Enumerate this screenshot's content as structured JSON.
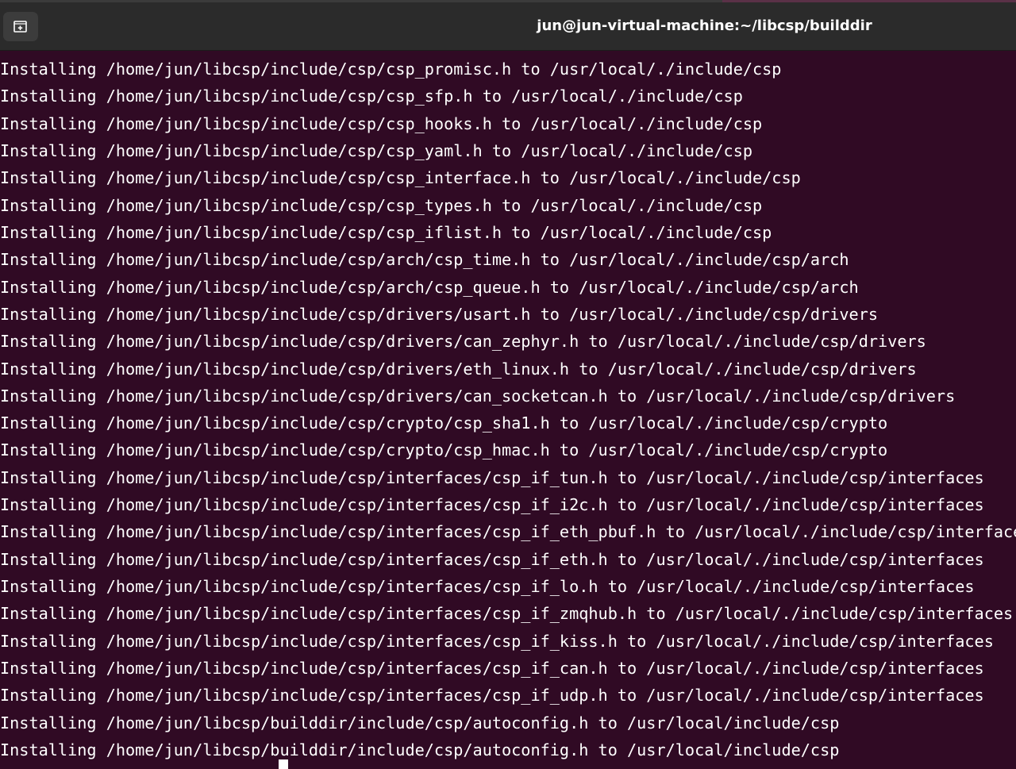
{
  "window": {
    "title": "jun@jun-virtual-machine:~/libcsp/builddir"
  },
  "toolbar": {
    "new_tab_icon": "new-tab-icon"
  },
  "terminal": {
    "lines": [
      "Installing /home/jun/libcsp/include/csp/csp_promisc.h to /usr/local/./include/csp",
      "Installing /home/jun/libcsp/include/csp/csp_sfp.h to /usr/local/./include/csp",
      "Installing /home/jun/libcsp/include/csp/csp_hooks.h to /usr/local/./include/csp",
      "Installing /home/jun/libcsp/include/csp/csp_yaml.h to /usr/local/./include/csp",
      "Installing /home/jun/libcsp/include/csp/csp_interface.h to /usr/local/./include/csp",
      "Installing /home/jun/libcsp/include/csp/csp_types.h to /usr/local/./include/csp",
      "Installing /home/jun/libcsp/include/csp/csp_iflist.h to /usr/local/./include/csp",
      "Installing /home/jun/libcsp/include/csp/arch/csp_time.h to /usr/local/./include/csp/arch",
      "Installing /home/jun/libcsp/include/csp/arch/csp_queue.h to /usr/local/./include/csp/arch",
      "Installing /home/jun/libcsp/include/csp/drivers/usart.h to /usr/local/./include/csp/drivers",
      "Installing /home/jun/libcsp/include/csp/drivers/can_zephyr.h to /usr/local/./include/csp/drivers",
      "Installing /home/jun/libcsp/include/csp/drivers/eth_linux.h to /usr/local/./include/csp/drivers",
      "Installing /home/jun/libcsp/include/csp/drivers/can_socketcan.h to /usr/local/./include/csp/drivers",
      "Installing /home/jun/libcsp/include/csp/crypto/csp_sha1.h to /usr/local/./include/csp/crypto",
      "Installing /home/jun/libcsp/include/csp/crypto/csp_hmac.h to /usr/local/./include/csp/crypto",
      "Installing /home/jun/libcsp/include/csp/interfaces/csp_if_tun.h to /usr/local/./include/csp/interfaces",
      "Installing /home/jun/libcsp/include/csp/interfaces/csp_if_i2c.h to /usr/local/./include/csp/interfaces",
      "Installing /home/jun/libcsp/include/csp/interfaces/csp_if_eth_pbuf.h to /usr/local/./include/csp/interfaces",
      "Installing /home/jun/libcsp/include/csp/interfaces/csp_if_eth.h to /usr/local/./include/csp/interfaces",
      "Installing /home/jun/libcsp/include/csp/interfaces/csp_if_lo.h to /usr/local/./include/csp/interfaces",
      "Installing /home/jun/libcsp/include/csp/interfaces/csp_if_zmqhub.h to /usr/local/./include/csp/interfaces",
      "Installing /home/jun/libcsp/include/csp/interfaces/csp_if_kiss.h to /usr/local/./include/csp/interfaces",
      "Installing /home/jun/libcsp/include/csp/interfaces/csp_if_can.h to /usr/local/./include/csp/interfaces",
      "Installing /home/jun/libcsp/include/csp/interfaces/csp_if_udp.h to /usr/local/./include/csp/interfaces",
      "Installing /home/jun/libcsp/builddir/include/csp/autoconfig.h to /usr/local/include/csp",
      "Installing /home/jun/libcsp/builddir/include/csp/autoconfig.h to /usr/local/include/csp"
    ]
  },
  "colors": {
    "background": "#300a24",
    "titlebar": "#2b2b2b",
    "text": "#ffffff"
  }
}
